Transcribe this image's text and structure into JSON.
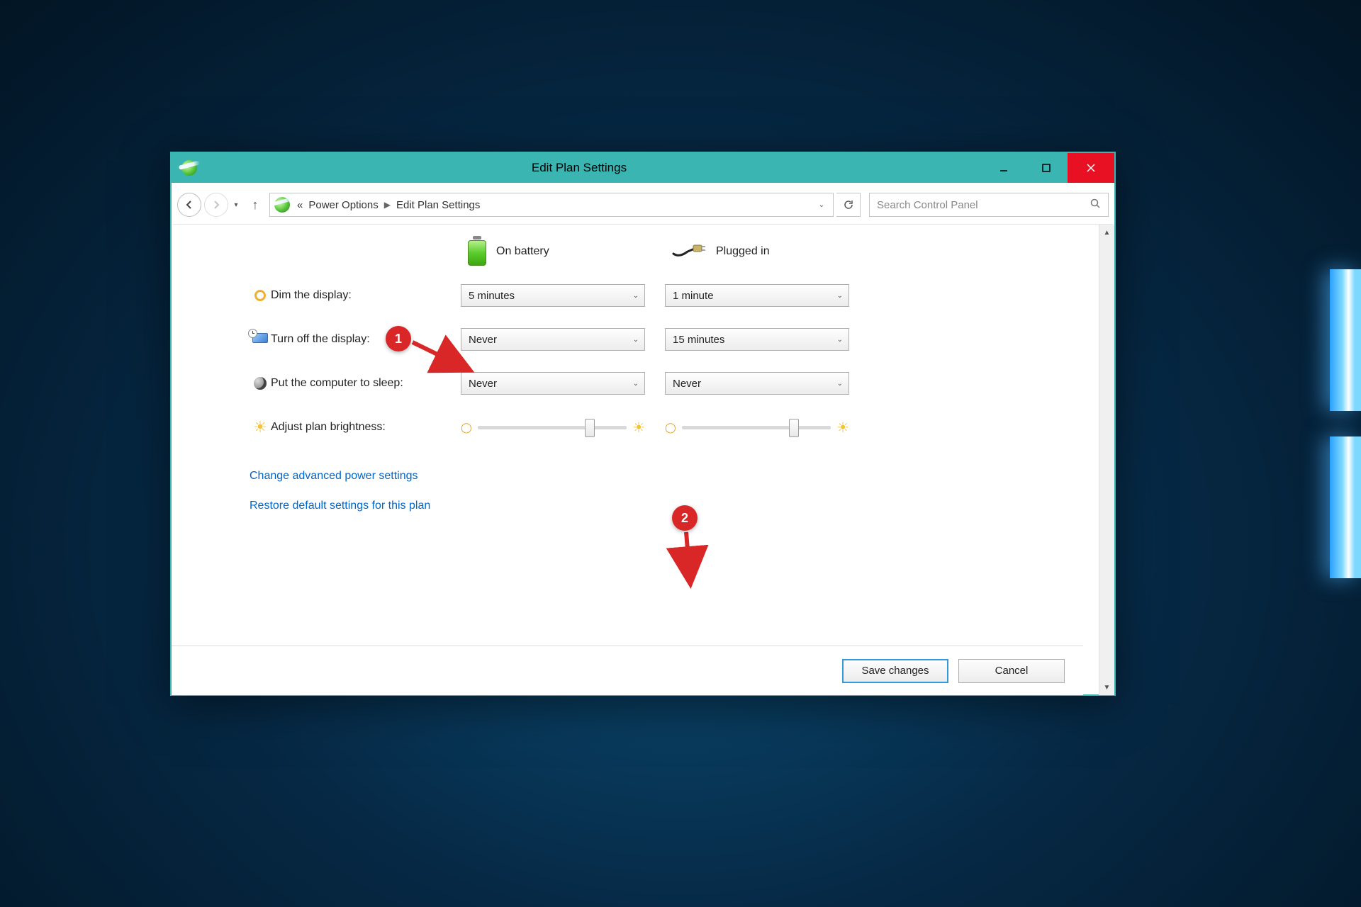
{
  "window": {
    "title": "Edit Plan Settings"
  },
  "nav": {
    "breadcrumb_prefix": "«",
    "crumb1": "Power Options",
    "crumb2": "Edit Plan Settings",
    "search_placeholder": "Search Control Panel"
  },
  "columns": {
    "battery": "On battery",
    "plugged": "Plugged in"
  },
  "settings": {
    "dim": {
      "label": "Dim the display:",
      "battery": "5 minutes",
      "plugged": "1 minute"
    },
    "turn_off": {
      "label": "Turn off the display:",
      "battery": "Never",
      "plugged": "15 minutes"
    },
    "sleep": {
      "label": "Put the computer to sleep:",
      "battery": "Never",
      "plugged": "Never"
    },
    "brightness": {
      "label": "Adjust plan brightness:"
    }
  },
  "links": {
    "advanced": "Change advanced power settings",
    "restore": "Restore default settings for this plan"
  },
  "buttons": {
    "save": "Save changes",
    "cancel": "Cancel"
  },
  "annotations": {
    "one": "1",
    "two": "2"
  }
}
